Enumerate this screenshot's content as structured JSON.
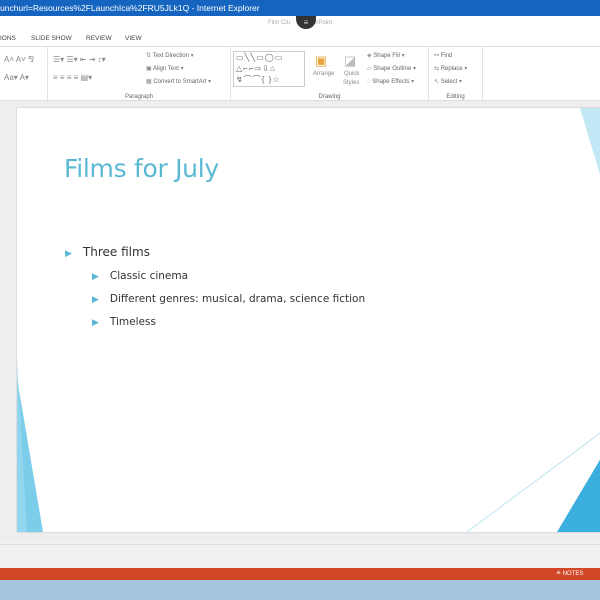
{
  "window": {
    "title": "unchurl=Resources%2FLaunchIca%2FRU5JLk1Q - Internet Explorer"
  },
  "app": {
    "title_left": "Film Clu",
    "title_right": "erPoint",
    "menu_icon": "hamburger-icon"
  },
  "tabs": [
    "IONS",
    "SLIDE SHOW",
    "REVIEW",
    "VIEW"
  ],
  "ribbon": {
    "paragraph": {
      "label": "Paragraph",
      "text_direction": "Text Direction",
      "align_text": "Align Text",
      "convert_smartart": "Convert to SmartArt"
    },
    "drawing": {
      "label": "Drawing",
      "arrange": "Arrange",
      "quick_styles_1": "Quick",
      "quick_styles_2": "Styles",
      "shape_fill": "Shape Fill",
      "shape_outline": "Shape Outline",
      "shape_effects": "Shape Effects"
    },
    "editing": {
      "label": "Editing",
      "find": "Find",
      "replace": "Replace",
      "select": "Select"
    }
  },
  "slide": {
    "title": "Films for July",
    "bullets": [
      {
        "text": "Three films",
        "level": 1
      },
      {
        "text": "Classic cinema",
        "level": 2
      },
      {
        "text": "Different genres: musical, drama, science fiction",
        "level": 2
      },
      {
        "text": "Timeless",
        "level": 2
      }
    ],
    "accent_color": "#5bb8d4"
  },
  "status": {
    "notes": "NOTES",
    "bar_color": "#d24726"
  }
}
